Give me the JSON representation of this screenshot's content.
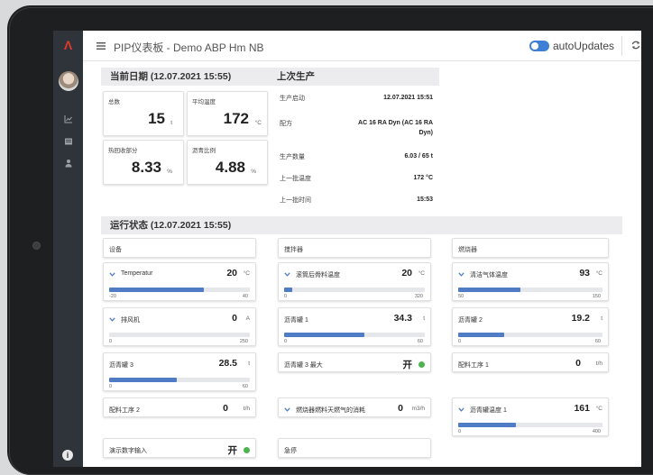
{
  "header": {
    "title": "PIP仪表板 - Demo ABP Hm NB",
    "auto_updates_label": "autoUpdates",
    "auto_updates_on": true
  },
  "sections": {
    "current_date": "当前日期 (12.07.2021 15:55)",
    "last_production": "上次生产",
    "run_status": "运行状态 (12.07.2021 15:55)"
  },
  "kpis": [
    {
      "label": "总数",
      "value": "15",
      "unit": "t"
    },
    {
      "label": "平均温度",
      "value": "172",
      "unit": "°C"
    },
    {
      "label": "热回收部分",
      "value": "8.33",
      "unit": "%"
    },
    {
      "label": "沥青比例",
      "value": "4.88",
      "unit": "%"
    }
  ],
  "last_production": [
    {
      "label": "生产启动",
      "value": "12.07.2021 15:51"
    },
    {
      "label": "配方",
      "value": "AC 16 RA Dyn (AC 16 RA Dyn)"
    },
    {
      "label": "生产数量",
      "value": "6.03 / 65 t"
    },
    {
      "label": "上一批温度",
      "value": "172 °C"
    },
    {
      "label": "上一批时间",
      "value": "15:53"
    }
  ],
  "groups": [
    "设备",
    "搅拌器",
    "燃烧器"
  ],
  "metrics": [
    {
      "label": "Temperatur",
      "value": "20",
      "unit": "°C",
      "min": "-20",
      "max": "40",
      "fill": 0.67,
      "chevron": true
    },
    {
      "label": "滚筒后骨料温度",
      "value": "20",
      "unit": "°C",
      "min": "0",
      "max": "320",
      "fill": 0.06,
      "chevron": true
    },
    {
      "label": "清洁气体温度",
      "value": "93",
      "unit": "°C",
      "min": "50",
      "max": "150",
      "fill": 0.43,
      "chevron": true
    },
    {
      "label": "排风机",
      "value": "0",
      "unit": "A",
      "min": "0",
      "max": "250",
      "fill": 0.0,
      "chevron": true
    },
    {
      "label": "沥青罐 1",
      "value": "34.3",
      "unit": "t",
      "min": "0",
      "max": "60",
      "fill": 0.57,
      "chevron": false
    },
    {
      "label": "沥青罐 2",
      "value": "19.2",
      "unit": "t",
      "min": "0",
      "max": "60",
      "fill": 0.32,
      "chevron": false
    },
    {
      "label": "沥青罐 3",
      "value": "28.5",
      "unit": "t",
      "min": "0",
      "max": "60",
      "fill": 0.48,
      "chevron": false
    },
    {
      "label": "沥青罐 3 最大",
      "value": "开",
      "unit": "",
      "status": "on"
    },
    {
      "label": "配料工序 1",
      "value": "0",
      "unit": "t/h"
    },
    {
      "label": "配料工序 2",
      "value": "0",
      "unit": "t/h"
    },
    {
      "label": "燃烧器燃料天燃气的消耗",
      "value": "0",
      "unit": "m3/h",
      "chevron": true
    },
    {
      "label": "沥青罐温度 1",
      "value": "161",
      "unit": "°C",
      "min": "0",
      "max": "400",
      "fill": 0.4,
      "chevron": true
    },
    {
      "label": "演示数字输入",
      "value": "开",
      "unit": "",
      "status": "on"
    },
    {
      "label": "急停",
      "value": "",
      "unit": ""
    }
  ],
  "colors": {
    "accent": "#4f7cc4",
    "toggle": "#3f7fd6",
    "status_on": "#4cb34f",
    "sidebar": "#2e343a",
    "logo": "#e03a2a"
  },
  "icons": {
    "menu": "menu-icon",
    "refresh": "refresh-icon",
    "chart": "chart-icon",
    "list": "list-icon",
    "user": "user-icon",
    "info": "info-icon"
  }
}
